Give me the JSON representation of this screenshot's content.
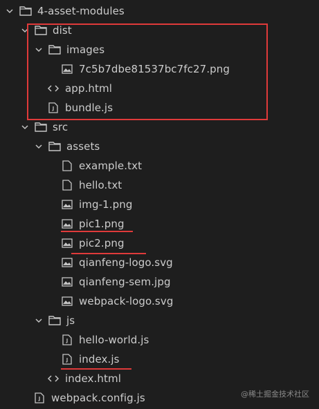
{
  "explorer": {
    "root": {
      "label": "4-asset-modules"
    },
    "dist": {
      "label": "dist",
      "images": {
        "label": "images",
        "files": [
          "7c5b7dbe81537bc7fc27.png"
        ]
      },
      "files": [
        "app.html",
        "bundle.js"
      ]
    },
    "src": {
      "label": "src",
      "assets": {
        "label": "assets",
        "files": [
          "example.txt",
          "hello.txt",
          "img-1.png",
          "pic1.png",
          "pic2.png",
          "qianfeng-logo.svg",
          "qianfeng-sem.jpg",
          "webpack-logo.svg"
        ]
      },
      "js": {
        "label": "js",
        "files": [
          "hello-world.js",
          "index.js"
        ]
      },
      "files": [
        "index.html"
      ]
    },
    "root_files": [
      "webpack.config.js"
    ]
  },
  "annotations": {
    "box_color": "#e03a3a",
    "underline_color": "#e03a3a"
  },
  "watermark": "@稀土掘金技术社区"
}
